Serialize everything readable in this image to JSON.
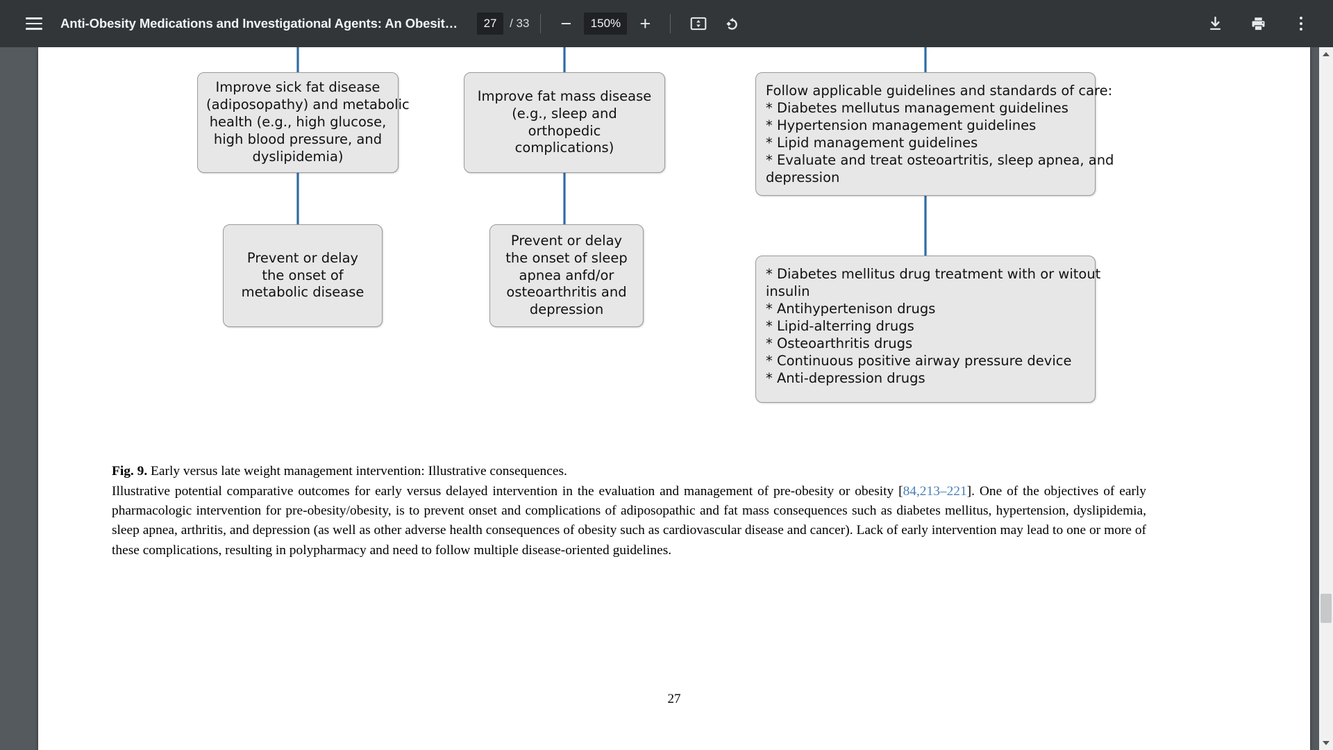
{
  "toolbar": {
    "menu_label": "Menu",
    "doc_title": "Anti-Obesity Medications and Investigational Agents: An Obesit…",
    "page_current": "27",
    "page_total": "/ 33",
    "zoom_out_label": "−",
    "zoom_level": "150%",
    "zoom_in_label": "+",
    "fit_label": "Fit to page",
    "rotate_label": "Rotate counterclockwise",
    "download_label": "Download",
    "print_label": "Print",
    "more_label": "More actions",
    "icons": {
      "menu": "hamburger-menu-icon",
      "fit": "fit-to-page-icon",
      "rotate": "rotate-counterclockwise-icon",
      "download": "download-icon",
      "print": "print-icon",
      "more": "more-vertical-icon"
    }
  },
  "colors": {
    "toolbar_bg": "#323639",
    "viewer_bg": "#545a5d",
    "page_bg": "#ffffff",
    "node_fill": "#e7e7e7",
    "node_border": "#9a9a9a",
    "connector": "#2e6ca4",
    "citation_link": "#4a7fb5"
  },
  "figure": {
    "nodes": [
      {
        "id": "adiposopathy",
        "lines": [
          "Improve sick fat disease",
          "(adiposopathy) and metabolic",
          "health (e.g., high glucose,",
          "high blood pressure, and",
          "dyslipidemia)"
        ]
      },
      {
        "id": "fatmass",
        "lines": [
          "Improve fat mass disease",
          "(e.g., sleep and",
          "orthopedic",
          "complications)"
        ]
      },
      {
        "id": "guidelines",
        "lines": [
          "Follow applicable guidelines and standards of care:",
          "* Diabetes mellutus management guidelines",
          "* Hypertension management guidelines",
          "* Lipid management guidelines",
          "* Evaluate and treat osteoartritis, sleep apnea, and",
          "depression"
        ]
      },
      {
        "id": "metabolic",
        "lines": [
          "Prevent or delay",
          "the onset of",
          "metabolic disease"
        ]
      },
      {
        "id": "sleepapnea",
        "lines": [
          "Prevent or delay",
          "the onset of sleep",
          "apnea anfd/or",
          "osteoarthritis and",
          "depression"
        ]
      },
      {
        "id": "drugs",
        "lines": [
          "* Diabetes mellitus drug treatment with or witout",
          "insulin",
          "* Antihypertenison drugs",
          "* Lipid-alterring drugs",
          "* Osteoarthritis drugs",
          "* Continuous positive airway pressure device",
          "* Anti-depression drugs"
        ]
      }
    ]
  },
  "caption": {
    "fig_label": "Fig. 9.",
    "fig_title": "Early versus late weight management intervention: Illustrative consequences.",
    "body_part1": "Illustrative potential comparative outcomes for early versus delayed intervention in the evaluation and management of pre-obesity or obesity [",
    "citation": "84,213–221",
    "body_part2": "]. One of the objectives of early pharmacologic intervention for pre-obesity/obesity, is to prevent onset and complications of adiposopathic and fat mass consequences such as diabetes mellitus, hypertension, dyslipidemia, sleep apnea, arthritis, and depression (as well as other adverse health consequences of obesity such as cardiovascular disease and cancer). Lack of early intervention may lead to one or more of these complications, resulting in polypharmacy and need to follow multiple disease-oriented guidelines."
  },
  "page_footer": {
    "page_number": "27"
  },
  "scrollbar": {
    "up_label": "Scroll up",
    "down_label": "Scroll down",
    "thumb_label": "Scroll thumb"
  }
}
